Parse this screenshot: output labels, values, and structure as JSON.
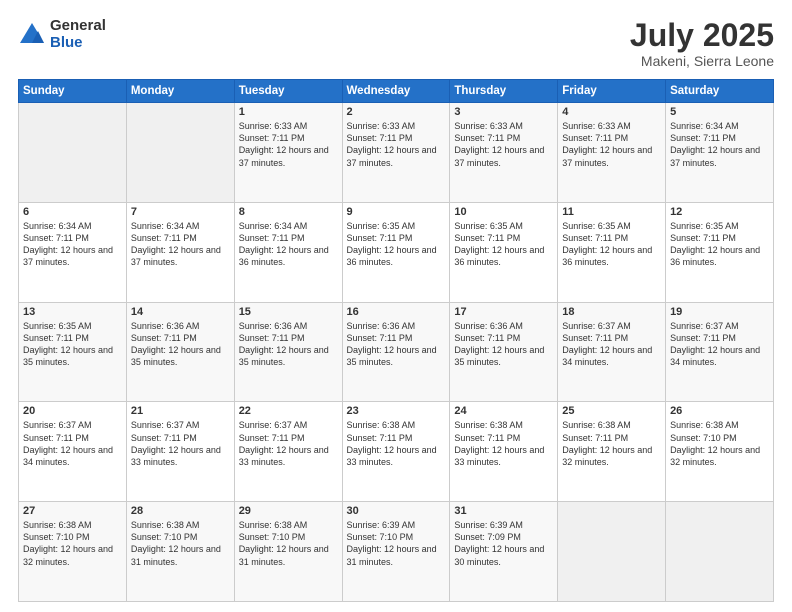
{
  "logo": {
    "general": "General",
    "blue": "Blue"
  },
  "title": "July 2025",
  "location": "Makeni, Sierra Leone",
  "days_of_week": [
    "Sunday",
    "Monday",
    "Tuesday",
    "Wednesday",
    "Thursday",
    "Friday",
    "Saturday"
  ],
  "weeks": [
    [
      {
        "day": "",
        "info": ""
      },
      {
        "day": "",
        "info": ""
      },
      {
        "day": "1",
        "info": "Sunrise: 6:33 AM\nSunset: 7:11 PM\nDaylight: 12 hours and 37 minutes."
      },
      {
        "day": "2",
        "info": "Sunrise: 6:33 AM\nSunset: 7:11 PM\nDaylight: 12 hours and 37 minutes."
      },
      {
        "day": "3",
        "info": "Sunrise: 6:33 AM\nSunset: 7:11 PM\nDaylight: 12 hours and 37 minutes."
      },
      {
        "day": "4",
        "info": "Sunrise: 6:33 AM\nSunset: 7:11 PM\nDaylight: 12 hours and 37 minutes."
      },
      {
        "day": "5",
        "info": "Sunrise: 6:34 AM\nSunset: 7:11 PM\nDaylight: 12 hours and 37 minutes."
      }
    ],
    [
      {
        "day": "6",
        "info": "Sunrise: 6:34 AM\nSunset: 7:11 PM\nDaylight: 12 hours and 37 minutes."
      },
      {
        "day": "7",
        "info": "Sunrise: 6:34 AM\nSunset: 7:11 PM\nDaylight: 12 hours and 37 minutes."
      },
      {
        "day": "8",
        "info": "Sunrise: 6:34 AM\nSunset: 7:11 PM\nDaylight: 12 hours and 36 minutes."
      },
      {
        "day": "9",
        "info": "Sunrise: 6:35 AM\nSunset: 7:11 PM\nDaylight: 12 hours and 36 minutes."
      },
      {
        "day": "10",
        "info": "Sunrise: 6:35 AM\nSunset: 7:11 PM\nDaylight: 12 hours and 36 minutes."
      },
      {
        "day": "11",
        "info": "Sunrise: 6:35 AM\nSunset: 7:11 PM\nDaylight: 12 hours and 36 minutes."
      },
      {
        "day": "12",
        "info": "Sunrise: 6:35 AM\nSunset: 7:11 PM\nDaylight: 12 hours and 36 minutes."
      }
    ],
    [
      {
        "day": "13",
        "info": "Sunrise: 6:35 AM\nSunset: 7:11 PM\nDaylight: 12 hours and 35 minutes."
      },
      {
        "day": "14",
        "info": "Sunrise: 6:36 AM\nSunset: 7:11 PM\nDaylight: 12 hours and 35 minutes."
      },
      {
        "day": "15",
        "info": "Sunrise: 6:36 AM\nSunset: 7:11 PM\nDaylight: 12 hours and 35 minutes."
      },
      {
        "day": "16",
        "info": "Sunrise: 6:36 AM\nSunset: 7:11 PM\nDaylight: 12 hours and 35 minutes."
      },
      {
        "day": "17",
        "info": "Sunrise: 6:36 AM\nSunset: 7:11 PM\nDaylight: 12 hours and 35 minutes."
      },
      {
        "day": "18",
        "info": "Sunrise: 6:37 AM\nSunset: 7:11 PM\nDaylight: 12 hours and 34 minutes."
      },
      {
        "day": "19",
        "info": "Sunrise: 6:37 AM\nSunset: 7:11 PM\nDaylight: 12 hours and 34 minutes."
      }
    ],
    [
      {
        "day": "20",
        "info": "Sunrise: 6:37 AM\nSunset: 7:11 PM\nDaylight: 12 hours and 34 minutes."
      },
      {
        "day": "21",
        "info": "Sunrise: 6:37 AM\nSunset: 7:11 PM\nDaylight: 12 hours and 33 minutes."
      },
      {
        "day": "22",
        "info": "Sunrise: 6:37 AM\nSunset: 7:11 PM\nDaylight: 12 hours and 33 minutes."
      },
      {
        "day": "23",
        "info": "Sunrise: 6:38 AM\nSunset: 7:11 PM\nDaylight: 12 hours and 33 minutes."
      },
      {
        "day": "24",
        "info": "Sunrise: 6:38 AM\nSunset: 7:11 PM\nDaylight: 12 hours and 33 minutes."
      },
      {
        "day": "25",
        "info": "Sunrise: 6:38 AM\nSunset: 7:11 PM\nDaylight: 12 hours and 32 minutes."
      },
      {
        "day": "26",
        "info": "Sunrise: 6:38 AM\nSunset: 7:10 PM\nDaylight: 12 hours and 32 minutes."
      }
    ],
    [
      {
        "day": "27",
        "info": "Sunrise: 6:38 AM\nSunset: 7:10 PM\nDaylight: 12 hours and 32 minutes."
      },
      {
        "day": "28",
        "info": "Sunrise: 6:38 AM\nSunset: 7:10 PM\nDaylight: 12 hours and 31 minutes."
      },
      {
        "day": "29",
        "info": "Sunrise: 6:38 AM\nSunset: 7:10 PM\nDaylight: 12 hours and 31 minutes."
      },
      {
        "day": "30",
        "info": "Sunrise: 6:39 AM\nSunset: 7:10 PM\nDaylight: 12 hours and 31 minutes."
      },
      {
        "day": "31",
        "info": "Sunrise: 6:39 AM\nSunset: 7:09 PM\nDaylight: 12 hours and 30 minutes."
      },
      {
        "day": "",
        "info": ""
      },
      {
        "day": "",
        "info": ""
      }
    ]
  ]
}
